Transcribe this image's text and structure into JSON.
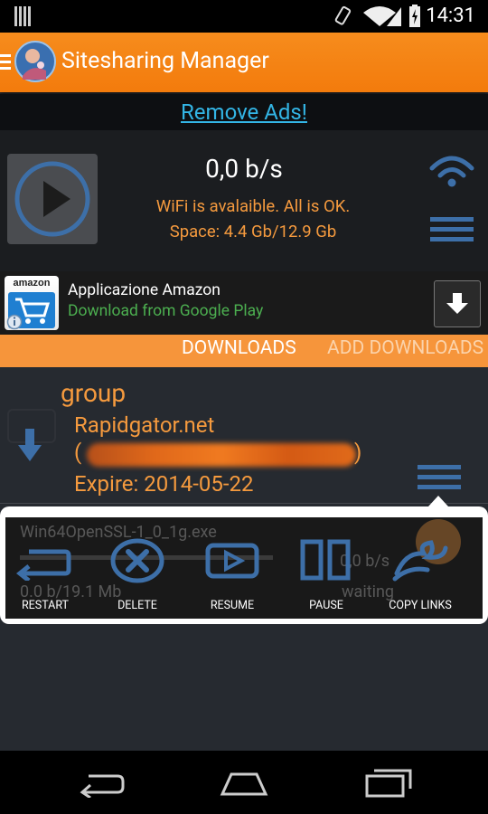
{
  "status_bar": {
    "time": "14:31"
  },
  "app": {
    "title": "Sitesharing Manager"
  },
  "ads": {
    "remove_ads": "Remove Ads!"
  },
  "stats": {
    "speed": "0,0 b/s",
    "wifi_status": "WiFi is avalaible. All is OK.",
    "space": "Space: 4.4 Gb/12.9 Gb"
  },
  "ad_banner": {
    "logo_text": "amazon",
    "title": "Applicazione Amazon",
    "subtitle": "Download from Google Play"
  },
  "tabs": {
    "downloads": "DOWNLOADS",
    "add_download": "ADD DOWNLOADS"
  },
  "group": {
    "name": "group",
    "host": "Rapidgator.net",
    "paren_open": "(",
    "paren_close": ")",
    "expire": "Expire: 2014-05-22"
  },
  "download": {
    "filename": "Win64OpenSSL-1_0_1g.exe",
    "speed": "0,0 b/s",
    "size": "0.0 b/19.1 Mb",
    "status": "waiting"
  },
  "actions": {
    "restart": "RESTART",
    "delete": "DELETE",
    "resume": "RESUME",
    "pause": "PAUSE",
    "copy_links": "COPY LINKS"
  },
  "colors": {
    "accent": "#f68c1d",
    "link": "#33b5e5",
    "text_orange": "#f59a3e"
  }
}
